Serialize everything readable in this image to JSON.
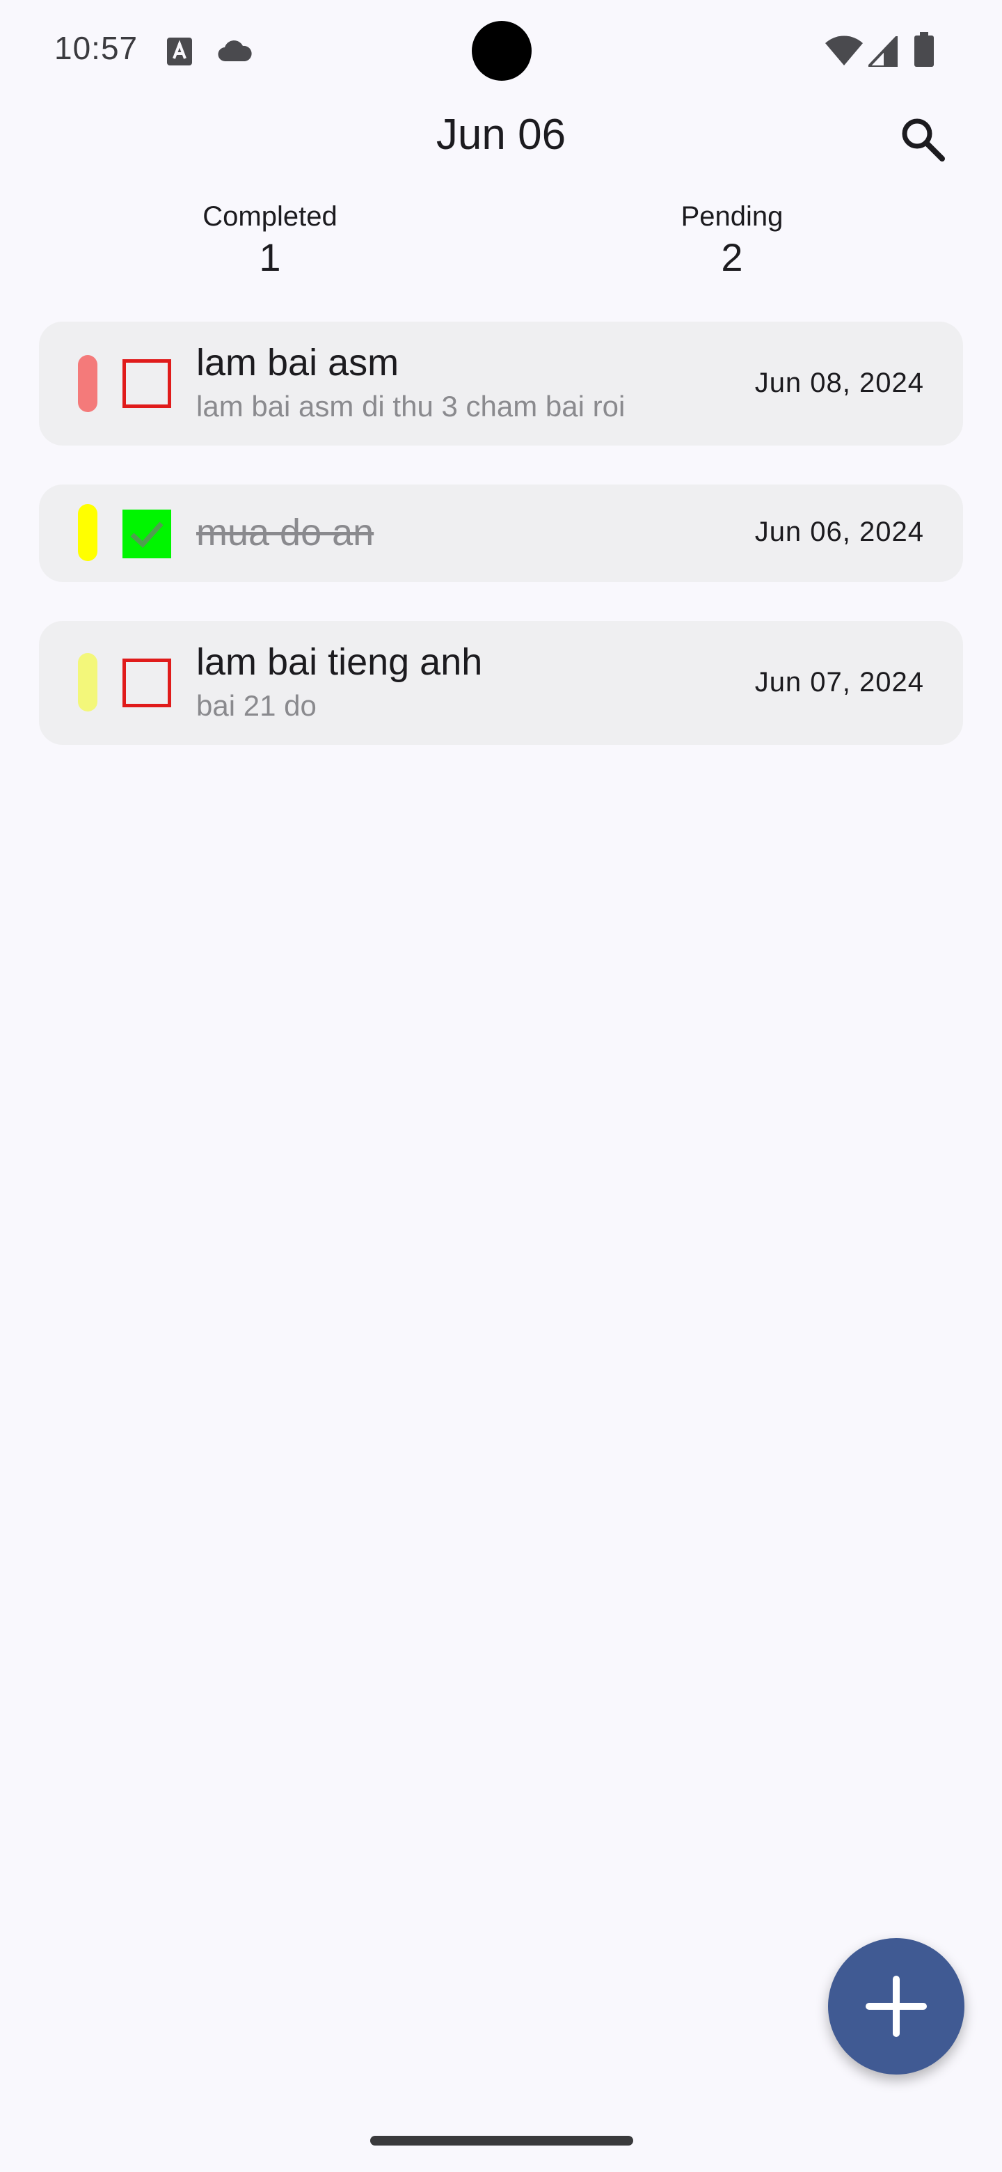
{
  "status_bar": {
    "time": "10:57",
    "icons": [
      "font-download-icon",
      "cloud-icon",
      "wifi-icon",
      "cellular-signal-icon",
      "battery-icon"
    ]
  },
  "header": {
    "title": "Jun 06",
    "search_icon": "search-icon"
  },
  "summary": {
    "completed_label": "Completed",
    "completed_count": "1",
    "pending_label": "Pending",
    "pending_count": "2"
  },
  "tasks": [
    {
      "title": "lam bai asm",
      "description": "lam bai asm di thu 3 cham bai roi",
      "date": "Jun 08, 2024",
      "completed": false,
      "priority_color": "#f47a7a"
    },
    {
      "title": "mua do an",
      "description": "",
      "date": "Jun 06, 2024",
      "completed": true,
      "priority_color": "#ffff00"
    },
    {
      "title": "lam bai tieng anh",
      "description": "bai 21 do",
      "date": "Jun 07, 2024",
      "completed": false,
      "priority_color": "#f3f77a"
    }
  ],
  "fab": {
    "icon": "plus-icon"
  },
  "colors": {
    "background": "#f9f8fd",
    "card": "#efeff1",
    "checkbox_border": "#e01b1b",
    "checkbox_checked": "#00f500",
    "fab": "#405a93"
  }
}
